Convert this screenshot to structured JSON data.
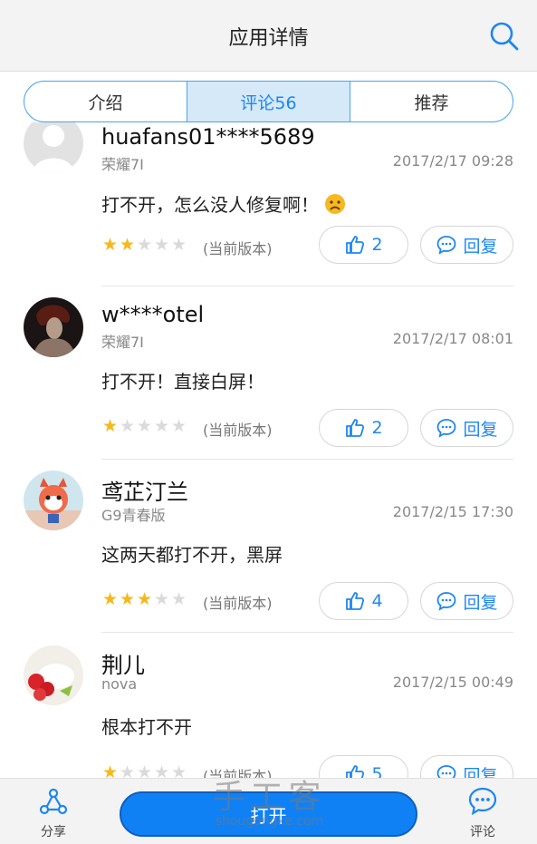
{
  "header": {
    "title": "应用详情"
  },
  "tabs": [
    {
      "label": "介绍"
    },
    {
      "label": "评论56"
    },
    {
      "label": "推荐"
    }
  ],
  "reviews": [
    {
      "username": "huafans01****5689",
      "device": "荣耀7I",
      "time": "2017/2/17 09:28",
      "text": "打不开，怎么没人修复啊！",
      "emoji": "sad-face-icon",
      "rating": 2,
      "version": "(当前版本)",
      "likes": "2",
      "reply_label": "回复"
    },
    {
      "username": "w****otel",
      "device": "荣耀7I",
      "time": "2017/2/17 08:01",
      "text": "打不开！直接白屏！",
      "rating": 1,
      "version": "(当前版本)",
      "likes": "2",
      "reply_label": "回复"
    },
    {
      "username": "鸢芷汀兰",
      "device": "G9青春版",
      "time": "2017/2/15 17:30",
      "text": "这两天都打不开，黑屏",
      "rating": 3,
      "version": "(当前版本)",
      "likes": "4",
      "reply_label": "回复"
    },
    {
      "username": "荆儿",
      "device": "nova",
      "time": "2017/2/15 00:49",
      "text": "根本打不开",
      "rating": 1,
      "version": "(当前版本)",
      "likes": "5",
      "reply_label": "回复"
    }
  ],
  "bottom_bar": {
    "share_label": "分享",
    "open_label": "打开",
    "comment_label": "评论"
  },
  "watermark": {
    "main": "手工客",
    "url": "shougongke.com"
  },
  "colors": {
    "accent": "#1e86f0",
    "star": "#f6b81a",
    "open_button": "#1081f5",
    "active_tab_bg": "#d5e9f9"
  }
}
